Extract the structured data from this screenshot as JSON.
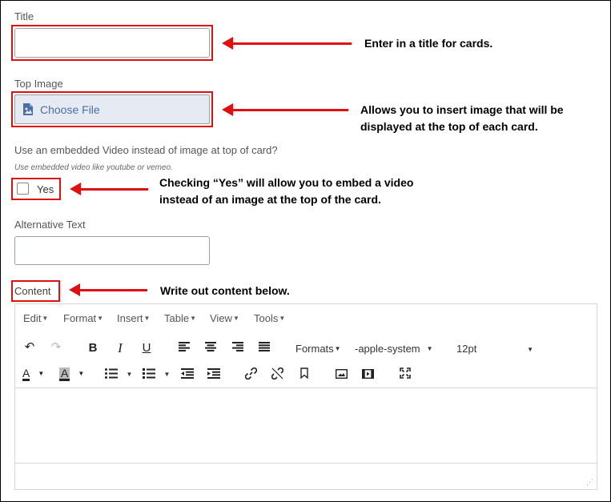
{
  "form": {
    "title_label": "Title",
    "top_image_label": "Top Image",
    "choose_file_label": "Choose File",
    "video_question": "Use an embedded Video instead of image at top of card?",
    "video_hint": "Use embedded video like youtube or vemeo.",
    "yes_label": "Yes",
    "alt_text_label": "Alternative Text",
    "content_label": "Content"
  },
  "annotations": {
    "title_note": "Enter in a title for cards.",
    "image_note_line1": "Allows you to insert image that will be",
    "image_note_line2": "displayed at the top of each card.",
    "yes_note_line1": "Checking “Yes” will allow you to embed a video",
    "yes_note_line2": "instead of an image at the top of the card.",
    "content_note": "Write out content below."
  },
  "editor": {
    "menus": [
      "Edit",
      "Format",
      "Insert",
      "Table",
      "View",
      "Tools"
    ],
    "formats_label": "Formats",
    "font_family": "-apple-system",
    "font_size": "12pt"
  },
  "colors": {
    "annotation_red": "#e01010",
    "file_button_bg": "#e6eaf3",
    "file_button_text": "#4a6fa5"
  }
}
